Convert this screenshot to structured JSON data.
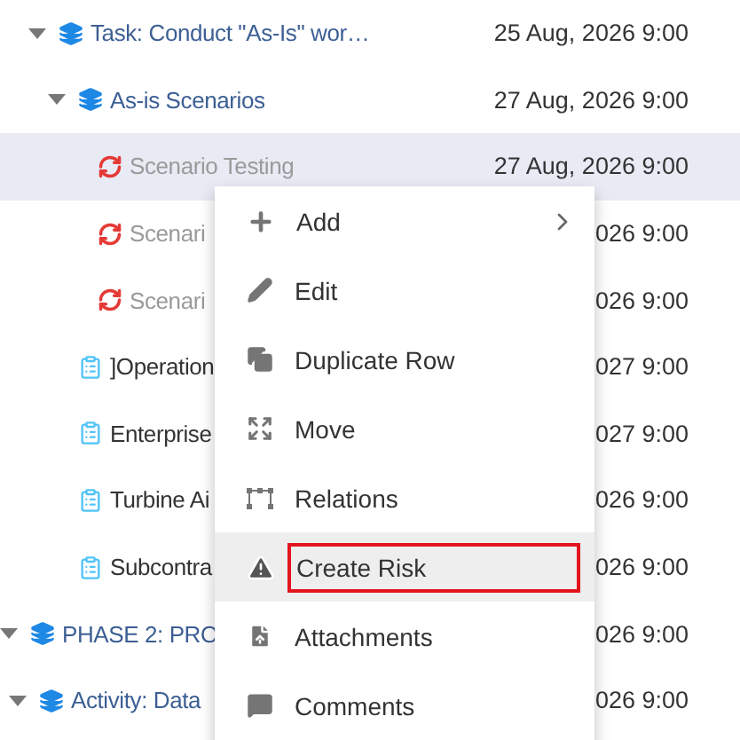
{
  "tree_upper": [
    {
      "kind": "group",
      "name": "Task: Conduct \"As-Is\" wor…",
      "date": "25 Aug, 2026 9:00",
      "expanded": true,
      "selected": false,
      "children": [
        {
          "kind": "group",
          "name": "As-is Scenarios",
          "date": "27 Aug, 2026 9:00",
          "expanded": true,
          "selected": false,
          "children": [
            {
              "kind": "scenario",
              "name": "Scenario Testing",
              "date": "27 Aug, 2026 9:00",
              "selected": true
            },
            {
              "kind": "scenario",
              "name": "Scenari",
              "date": "026 9:00",
              "selected": false
            },
            {
              "kind": "scenario",
              "name": "Scenari",
              "date": "026 9:00",
              "selected": false
            }
          ]
        },
        {
          "kind": "task",
          "name": "]Operation",
          "date": "027 9:00",
          "selected": false
        },
        {
          "kind": "task",
          "name": "Enterprise",
          "date": "027 9:00",
          "selected": false
        },
        {
          "kind": "task",
          "name": "Turbine Ai",
          "date": "026 9:00",
          "selected": false
        },
        {
          "kind": "task",
          "name": "Subcontra",
          "date": "026 9:00",
          "selected": false
        }
      ]
    }
  ],
  "tree_lower": [
    {
      "kind": "group",
      "name": "PHASE 2: PRO",
      "date": "026 9:00",
      "expanded": true,
      "selected": false,
      "children": [
        {
          "kind": "group",
          "name": "Activity: Data",
          "date": "026 9:00",
          "expanded": true,
          "selected": false
        }
      ]
    }
  ],
  "context_menu": [
    {
      "kind": "add",
      "label": "Add",
      "submenu": true,
      "selected": false,
      "annotated": false
    },
    {
      "kind": "edit",
      "label": "Edit",
      "submenu": false,
      "selected": false,
      "annotated": false
    },
    {
      "kind": "duplicate",
      "label": "Duplicate Row",
      "submenu": false,
      "selected": false,
      "annotated": false
    },
    {
      "kind": "move",
      "label": "Move",
      "submenu": false,
      "selected": false,
      "annotated": false
    },
    {
      "kind": "relations",
      "label": "Relations",
      "submenu": false,
      "selected": false,
      "annotated": false
    },
    {
      "kind": "risk",
      "label": "Create Risk",
      "submenu": false,
      "selected": true,
      "annotated": true
    },
    {
      "kind": "attachments",
      "label": "Attachments",
      "submenu": false,
      "selected": false,
      "annotated": false
    },
    {
      "kind": "comments",
      "label": "Comments",
      "submenu": false,
      "selected": false,
      "annotated": false
    }
  ]
}
